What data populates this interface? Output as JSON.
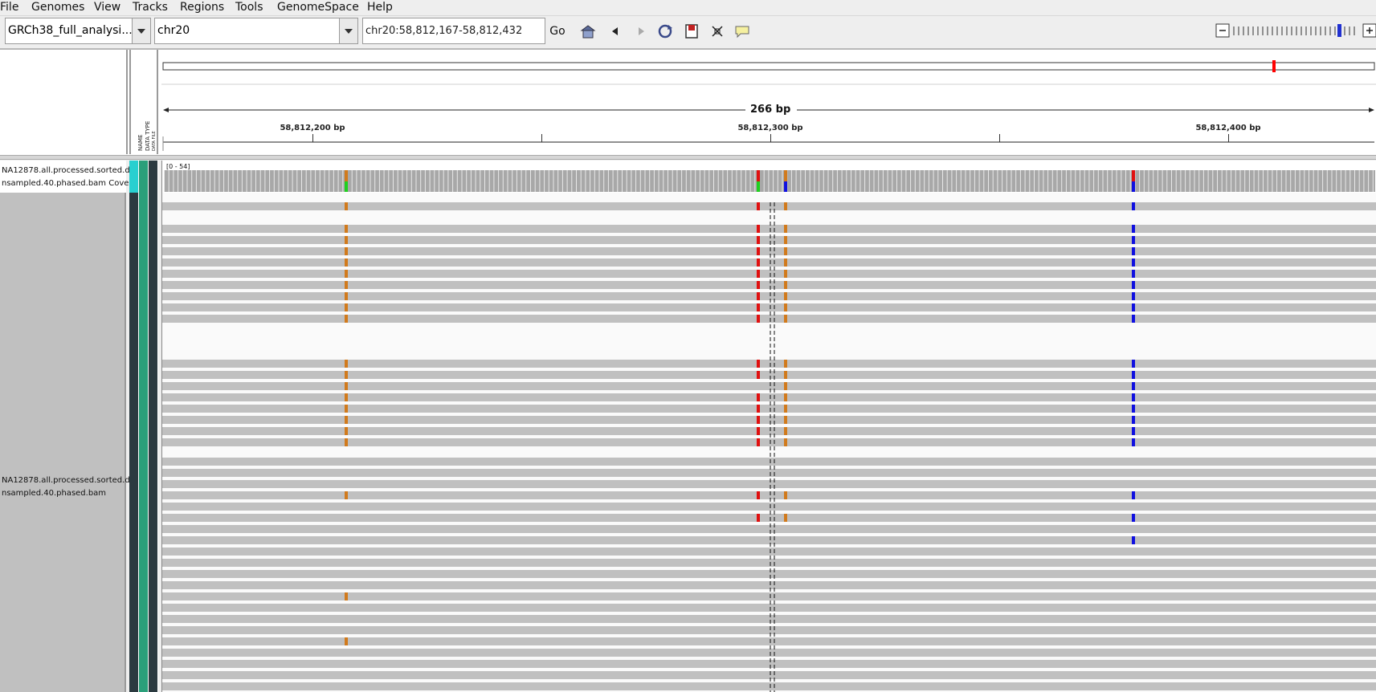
{
  "menubar": {
    "items": [
      "File",
      "Genomes",
      "View",
      "Tracks",
      "Regions",
      "Tools",
      "GenomeSpace",
      "Help"
    ]
  },
  "toolbar": {
    "genome": "GRCh38_full_analysi...",
    "chromosome": "chr20",
    "locus": "chr20:58,812,167-58,812,432",
    "go_label": "Go",
    "icons": [
      "home-icon",
      "back-icon",
      "forward-icon",
      "refresh-icon",
      "roi-icon",
      "resize-icon",
      "popup-info-icon"
    ]
  },
  "attributes": {
    "headers": [
      "NAME",
      "DATA TYPE",
      "DATA FILE"
    ]
  },
  "ruler": {
    "span_label": "266 bp",
    "tick_labels": [
      "58,812,200 bp",
      "58,812,300 bp",
      "58,812,400 bp"
    ],
    "ideogram_marker_color": "#ff0000"
  },
  "tracks": {
    "coverage_name_line1": "NA12878.all.processed.sorted.d",
    "coverage_name_line2": "nsampled.40.phased.bam Cove",
    "coverage_range": "[0 - 54]",
    "alignment_name_line1": "NA12878.all.processed.sorted.d",
    "alignment_name_line2": "nsampled.40.phased.bam"
  },
  "colors": {
    "read_gray": "#c0c0c0",
    "coverage_gray": "#a8a8a8",
    "mismatch_orange": "#d17a1c",
    "mismatch_red": "#e01010",
    "mismatch_blue": "#1010e0",
    "mismatch_green": "#20d020",
    "attr_cyan": "#28d0d0",
    "attr_teal": "#2a9f7a",
    "attr_dark": "#2b3a40"
  }
}
